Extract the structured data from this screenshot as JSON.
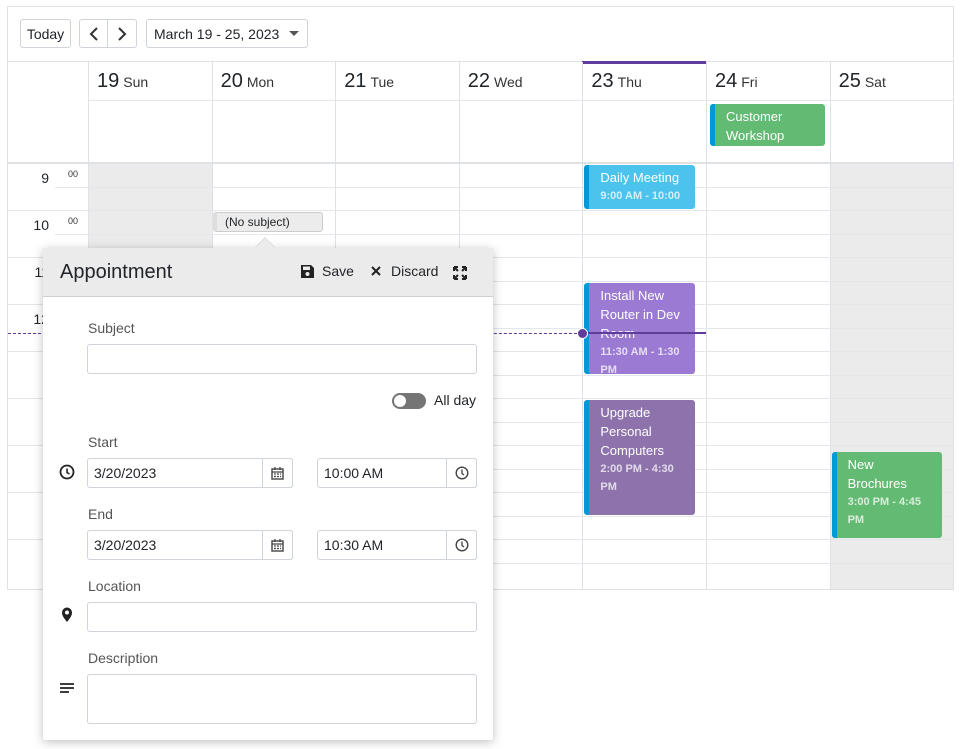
{
  "toolbar": {
    "today": "Today",
    "prev_icon": "chevron-left",
    "next_icon": "chevron-right",
    "range": "March 19 - 25, 2023"
  },
  "days": [
    {
      "num": "19",
      "name": "Sun",
      "weekend": true
    },
    {
      "num": "20",
      "name": "Mon",
      "weekend": false
    },
    {
      "num": "21",
      "name": "Tue",
      "weekend": false
    },
    {
      "num": "22",
      "name": "Wed",
      "weekend": false
    },
    {
      "num": "23",
      "name": "Thu",
      "weekend": false,
      "today": true
    },
    {
      "num": "24",
      "name": "Fri",
      "weekend": false
    },
    {
      "num": "25",
      "name": "Sat",
      "weekend": true
    }
  ],
  "hours": [
    "9",
    "10",
    "11",
    "12"
  ],
  "minute_label": "00",
  "current_time": "12:37",
  "colors": {
    "accent": "#5f3b9b",
    "event_border": "#0398d8"
  },
  "all_day_events": [
    {
      "title": "Customer Workshop",
      "day": 5,
      "color": "#63bb73"
    }
  ],
  "events": [
    {
      "title": "Daily Meeting",
      "time": "9:00 AM - 10:00 AM",
      "day": 4,
      "start": 9,
      "end": 10,
      "color": "#4cc3ec"
    },
    {
      "title": "Install New Router in Dev Room",
      "time": "11:30 AM - 1:30 PM",
      "day": 4,
      "start": 11.5,
      "end": 13.5,
      "color": "#9b7ad4"
    },
    {
      "title": "Upgrade Personal Computers",
      "time": "2:00 PM - 4:30 PM",
      "day": 4,
      "start": 14,
      "end": 16.5,
      "color": "#8d72ab"
    },
    {
      "title": "New Brochures",
      "time": "3:00 PM - 4:45 PM",
      "day": 6,
      "start": 15.1,
      "end": 17,
      "color": "#63bb73"
    }
  ],
  "draft_event": {
    "title": "(No subject)"
  },
  "popup": {
    "title": "Appointment",
    "save": "Save",
    "discard": "Discard",
    "subject_label": "Subject",
    "subject_value": "",
    "all_day_label": "All day",
    "all_day": false,
    "start_label": "Start",
    "start_date": "3/20/2023",
    "start_time": "10:00 AM",
    "end_label": "End",
    "end_date": "3/20/2023",
    "end_time": "10:30 AM",
    "location_label": "Location",
    "location_value": "",
    "description_label": "Description",
    "description_value": ""
  }
}
